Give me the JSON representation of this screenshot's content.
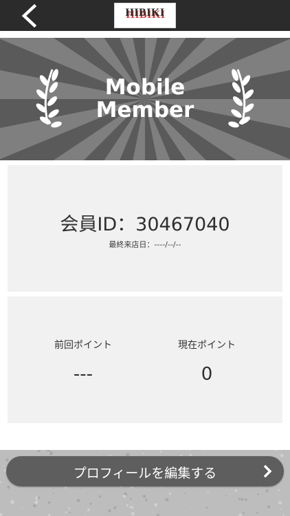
{
  "header": {
    "back_icon": "chevron-left-icon",
    "logo_text": "HIBIKI"
  },
  "hero": {
    "title_line1": "Mobile",
    "title_line2": "Member",
    "decor_icon": "laurel-icon"
  },
  "member": {
    "id_label": "会員ID：",
    "id_value": "30467040",
    "last_visit_label": "最終来店日：",
    "last_visit_value": "----/--/--"
  },
  "points": {
    "previous_label": "前回ポイント",
    "previous_value": "---",
    "current_label": "現在ポイント",
    "current_value": "0"
  },
  "actions": {
    "edit_profile_label": "プロフィールを編集する",
    "edit_icon": "chevron-right-icon"
  },
  "colors": {
    "topbar": "#2b2b2b",
    "hero_dark": "#5a5a5a",
    "hero_light": "#8a8a8a",
    "card": "#f1f1f1",
    "button": "#5e5e5e"
  }
}
